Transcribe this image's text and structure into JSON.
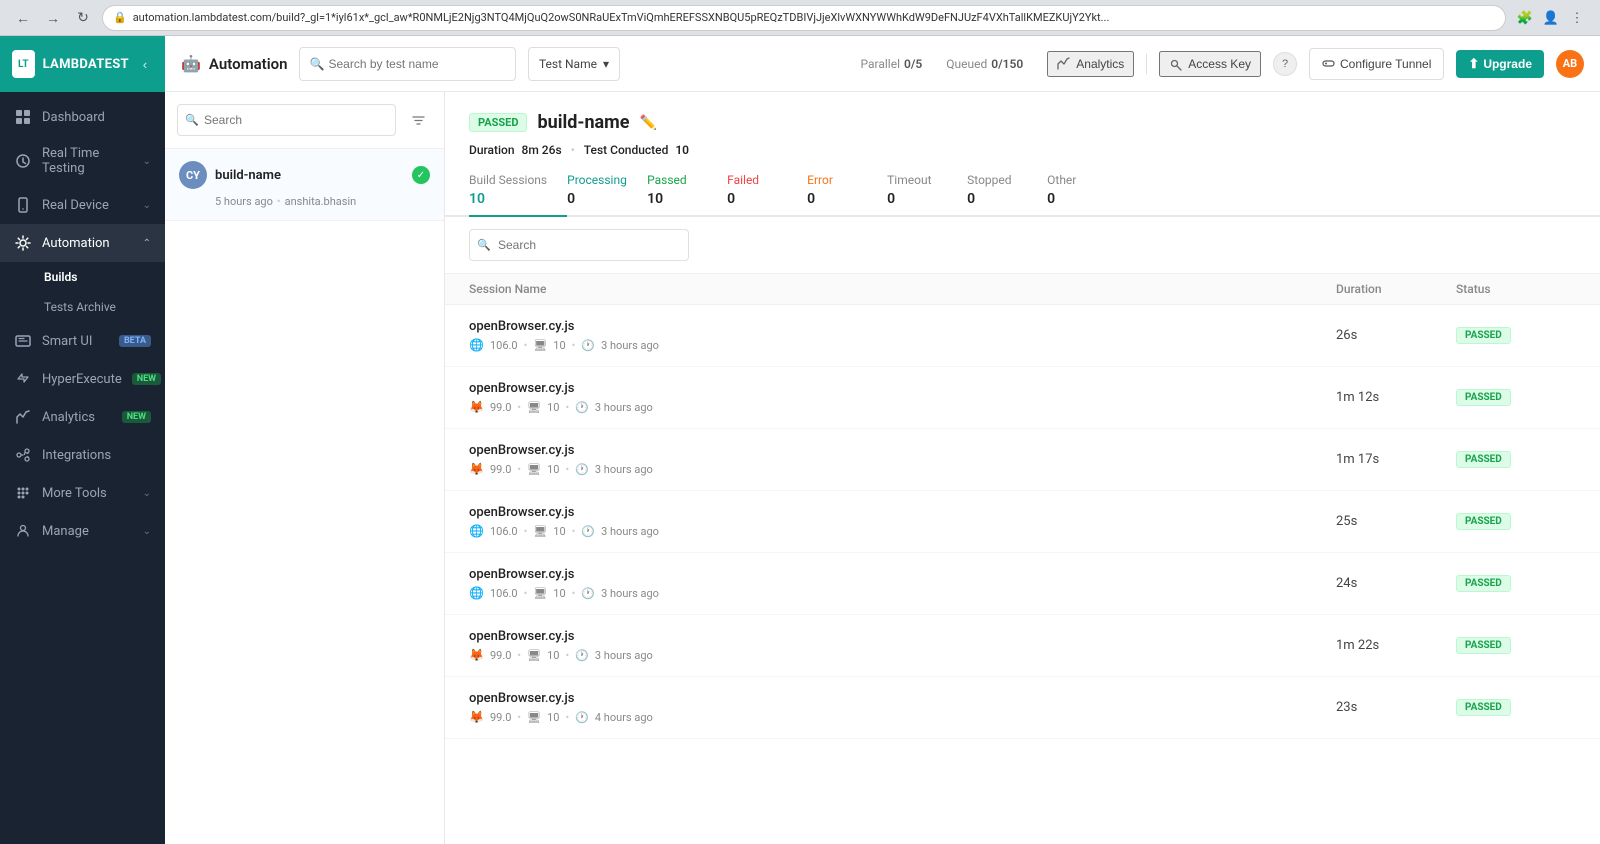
{
  "browser": {
    "url": "automation.lambdatest.com/build?_gl=1*iyl61x*_gcl_aw*R0NMLjE2Njg3NTQ4MjQuQ2owS0NRaUExTmViQmhEREFSSXNBQU5pREQzTDBIVjJjeXlvWXNYWWhKdW9DeFNJUzF4VXhTallKMEZKUjY2Ykt...",
    "back_enabled": false,
    "forward_enabled": false
  },
  "sidebar": {
    "logo_text": "LAMBDATEST",
    "items": [
      {
        "id": "dashboard",
        "label": "Dashboard",
        "icon": "dashboard-icon",
        "active": false
      },
      {
        "id": "real-time-testing",
        "label": "Real Time Testing",
        "icon": "realtime-icon",
        "has_chevron": true,
        "active": false
      },
      {
        "id": "real-device",
        "label": "Real Device",
        "icon": "device-icon",
        "has_chevron": true,
        "active": false
      },
      {
        "id": "automation",
        "label": "Automation",
        "icon": "automation-icon",
        "has_chevron": true,
        "active": true,
        "sub_items": [
          {
            "id": "builds",
            "label": "Builds",
            "active": true
          },
          {
            "id": "tests-archive",
            "label": "Tests Archive",
            "active": false
          }
        ]
      },
      {
        "id": "smart-ui",
        "label": "Smart UI",
        "icon": "smartui-icon",
        "badge": "BETA",
        "badge_type": "beta",
        "active": false
      },
      {
        "id": "hyperexecute",
        "label": "HyperExecute",
        "icon": "hyperexecute-icon",
        "badge": "NEW",
        "badge_type": "new",
        "active": false
      },
      {
        "id": "analytics",
        "label": "Analytics",
        "icon": "analytics-icon",
        "badge": "NEW",
        "badge_type": "new",
        "active": false
      },
      {
        "id": "integrations",
        "label": "Integrations",
        "icon": "integrations-icon",
        "active": false
      },
      {
        "id": "more-tools",
        "label": "More Tools",
        "icon": "tools-icon",
        "has_chevron": true,
        "active": false
      },
      {
        "id": "manage",
        "label": "Manage",
        "icon": "manage-icon",
        "has_chevron": true,
        "active": false
      }
    ]
  },
  "topbar": {
    "title": "Automation",
    "search_placeholder": "Search by test name",
    "test_name_label": "Test Name",
    "parallel_label": "Parallel",
    "parallel_value": "0/5",
    "queued_label": "Queued",
    "queued_value": "0/150",
    "analytics_label": "Analytics",
    "access_key_label": "Access Key",
    "configure_tunnel_label": "Configure Tunnel",
    "upgrade_label": "Upgrade",
    "user_initials": "AB"
  },
  "left_panel": {
    "search_placeholder": "Search",
    "build": {
      "avatar": "CY",
      "name": "build-name",
      "time_ago": "5 hours ago",
      "author": "anshita.bhasin",
      "status": "passed"
    }
  },
  "build_detail": {
    "status_badge": "PASSED",
    "title": "build-name",
    "duration_label": "Duration",
    "duration_value": "8m 26s",
    "test_conducted_label": "Test Conducted",
    "test_conducted_value": "10",
    "stats": [
      {
        "label": "Build Sessions",
        "value": "10",
        "active": true,
        "color": "default"
      },
      {
        "label": "Processing",
        "value": "0",
        "active": false,
        "color": "processing"
      },
      {
        "label": "Passed",
        "value": "10",
        "active": false,
        "color": "passed"
      },
      {
        "label": "Failed",
        "value": "0",
        "active": false,
        "color": "failed"
      },
      {
        "label": "Error",
        "value": "0",
        "active": false,
        "color": "error"
      },
      {
        "label": "Timeout",
        "value": "0",
        "active": false,
        "color": "default"
      },
      {
        "label": "Stopped",
        "value": "0",
        "active": false,
        "color": "default"
      },
      {
        "label": "Other",
        "value": "0",
        "active": false,
        "color": "default"
      }
    ],
    "table": {
      "col_session_name": "Session Name",
      "col_duration": "Duration",
      "col_status": "Status"
    },
    "sessions": [
      {
        "filename": "openBrowser.cy.js",
        "browser": "Chrome",
        "version": "106.0",
        "resolution": "10",
        "time_ago": "3 hours ago",
        "duration": "26s",
        "status": "PASSED"
      },
      {
        "filename": "openBrowser.cy.js",
        "browser": "Firefox",
        "version": "99.0",
        "resolution": "10",
        "time_ago": "3 hours ago",
        "duration": "1m 12s",
        "status": "PASSED"
      },
      {
        "filename": "openBrowser.cy.js",
        "browser": "Firefox",
        "version": "99.0",
        "resolution": "10",
        "time_ago": "3 hours ago",
        "duration": "1m 17s",
        "status": "PASSED"
      },
      {
        "filename": "openBrowser.cy.js",
        "browser": "Chrome",
        "version": "106.0",
        "resolution": "10",
        "time_ago": "3 hours ago",
        "duration": "25s",
        "status": "PASSED"
      },
      {
        "filename": "openBrowser.cy.js",
        "browser": "Chrome",
        "version": "106.0",
        "resolution": "10",
        "time_ago": "3 hours ago",
        "duration": "24s",
        "status": "PASSED"
      },
      {
        "filename": "openBrowser.cy.js",
        "browser": "Firefox",
        "version": "99.0",
        "resolution": "10",
        "time_ago": "3 hours ago",
        "duration": "1m 22s",
        "status": "PASSED"
      },
      {
        "filename": "openBrowser.cy.js",
        "browser": "Firefox",
        "version": "99.0",
        "resolution": "10",
        "time_ago": "4 hours ago",
        "duration": "23s",
        "status": "PASSED"
      }
    ]
  }
}
